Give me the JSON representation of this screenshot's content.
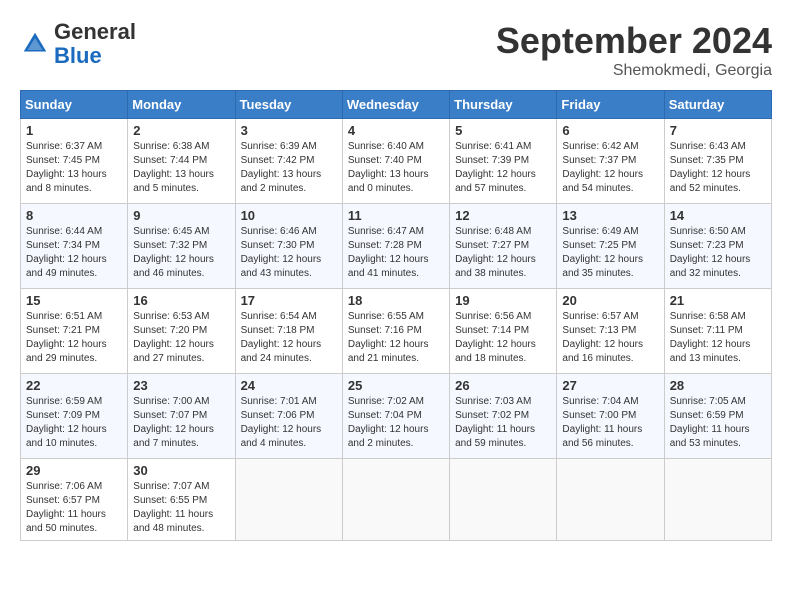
{
  "header": {
    "logo_general": "General",
    "logo_blue": "Blue",
    "month_title": "September 2024",
    "location": "Shemokmedi, Georgia"
  },
  "weekdays": [
    "Sunday",
    "Monday",
    "Tuesday",
    "Wednesday",
    "Thursday",
    "Friday",
    "Saturday"
  ],
  "weeks": [
    [
      {
        "day": "1",
        "sunrise": "Sunrise: 6:37 AM",
        "sunset": "Sunset: 7:45 PM",
        "daylight": "Daylight: 13 hours and 8 minutes."
      },
      {
        "day": "2",
        "sunrise": "Sunrise: 6:38 AM",
        "sunset": "Sunset: 7:44 PM",
        "daylight": "Daylight: 13 hours and 5 minutes."
      },
      {
        "day": "3",
        "sunrise": "Sunrise: 6:39 AM",
        "sunset": "Sunset: 7:42 PM",
        "daylight": "Daylight: 13 hours and 2 minutes."
      },
      {
        "day": "4",
        "sunrise": "Sunrise: 6:40 AM",
        "sunset": "Sunset: 7:40 PM",
        "daylight": "Daylight: 13 hours and 0 minutes."
      },
      {
        "day": "5",
        "sunrise": "Sunrise: 6:41 AM",
        "sunset": "Sunset: 7:39 PM",
        "daylight": "Daylight: 12 hours and 57 minutes."
      },
      {
        "day": "6",
        "sunrise": "Sunrise: 6:42 AM",
        "sunset": "Sunset: 7:37 PM",
        "daylight": "Daylight: 12 hours and 54 minutes."
      },
      {
        "day": "7",
        "sunrise": "Sunrise: 6:43 AM",
        "sunset": "Sunset: 7:35 PM",
        "daylight": "Daylight: 12 hours and 52 minutes."
      }
    ],
    [
      {
        "day": "8",
        "sunrise": "Sunrise: 6:44 AM",
        "sunset": "Sunset: 7:34 PM",
        "daylight": "Daylight: 12 hours and 49 minutes."
      },
      {
        "day": "9",
        "sunrise": "Sunrise: 6:45 AM",
        "sunset": "Sunset: 7:32 PM",
        "daylight": "Daylight: 12 hours and 46 minutes."
      },
      {
        "day": "10",
        "sunrise": "Sunrise: 6:46 AM",
        "sunset": "Sunset: 7:30 PM",
        "daylight": "Daylight: 12 hours and 43 minutes."
      },
      {
        "day": "11",
        "sunrise": "Sunrise: 6:47 AM",
        "sunset": "Sunset: 7:28 PM",
        "daylight": "Daylight: 12 hours and 41 minutes."
      },
      {
        "day": "12",
        "sunrise": "Sunrise: 6:48 AM",
        "sunset": "Sunset: 7:27 PM",
        "daylight": "Daylight: 12 hours and 38 minutes."
      },
      {
        "day": "13",
        "sunrise": "Sunrise: 6:49 AM",
        "sunset": "Sunset: 7:25 PM",
        "daylight": "Daylight: 12 hours and 35 minutes."
      },
      {
        "day": "14",
        "sunrise": "Sunrise: 6:50 AM",
        "sunset": "Sunset: 7:23 PM",
        "daylight": "Daylight: 12 hours and 32 minutes."
      }
    ],
    [
      {
        "day": "15",
        "sunrise": "Sunrise: 6:51 AM",
        "sunset": "Sunset: 7:21 PM",
        "daylight": "Daylight: 12 hours and 29 minutes."
      },
      {
        "day": "16",
        "sunrise": "Sunrise: 6:53 AM",
        "sunset": "Sunset: 7:20 PM",
        "daylight": "Daylight: 12 hours and 27 minutes."
      },
      {
        "day": "17",
        "sunrise": "Sunrise: 6:54 AM",
        "sunset": "Sunset: 7:18 PM",
        "daylight": "Daylight: 12 hours and 24 minutes."
      },
      {
        "day": "18",
        "sunrise": "Sunrise: 6:55 AM",
        "sunset": "Sunset: 7:16 PM",
        "daylight": "Daylight: 12 hours and 21 minutes."
      },
      {
        "day": "19",
        "sunrise": "Sunrise: 6:56 AM",
        "sunset": "Sunset: 7:14 PM",
        "daylight": "Daylight: 12 hours and 18 minutes."
      },
      {
        "day": "20",
        "sunrise": "Sunrise: 6:57 AM",
        "sunset": "Sunset: 7:13 PM",
        "daylight": "Daylight: 12 hours and 16 minutes."
      },
      {
        "day": "21",
        "sunrise": "Sunrise: 6:58 AM",
        "sunset": "Sunset: 7:11 PM",
        "daylight": "Daylight: 12 hours and 13 minutes."
      }
    ],
    [
      {
        "day": "22",
        "sunrise": "Sunrise: 6:59 AM",
        "sunset": "Sunset: 7:09 PM",
        "daylight": "Daylight: 12 hours and 10 minutes."
      },
      {
        "day": "23",
        "sunrise": "Sunrise: 7:00 AM",
        "sunset": "Sunset: 7:07 PM",
        "daylight": "Daylight: 12 hours and 7 minutes."
      },
      {
        "day": "24",
        "sunrise": "Sunrise: 7:01 AM",
        "sunset": "Sunset: 7:06 PM",
        "daylight": "Daylight: 12 hours and 4 minutes."
      },
      {
        "day": "25",
        "sunrise": "Sunrise: 7:02 AM",
        "sunset": "Sunset: 7:04 PM",
        "daylight": "Daylight: 12 hours and 2 minutes."
      },
      {
        "day": "26",
        "sunrise": "Sunrise: 7:03 AM",
        "sunset": "Sunset: 7:02 PM",
        "daylight": "Daylight: 11 hours and 59 minutes."
      },
      {
        "day": "27",
        "sunrise": "Sunrise: 7:04 AM",
        "sunset": "Sunset: 7:00 PM",
        "daylight": "Daylight: 11 hours and 56 minutes."
      },
      {
        "day": "28",
        "sunrise": "Sunrise: 7:05 AM",
        "sunset": "Sunset: 6:59 PM",
        "daylight": "Daylight: 11 hours and 53 minutes."
      }
    ],
    [
      {
        "day": "29",
        "sunrise": "Sunrise: 7:06 AM",
        "sunset": "Sunset: 6:57 PM",
        "daylight": "Daylight: 11 hours and 50 minutes."
      },
      {
        "day": "30",
        "sunrise": "Sunrise: 7:07 AM",
        "sunset": "Sunset: 6:55 PM",
        "daylight": "Daylight: 11 hours and 48 minutes."
      },
      null,
      null,
      null,
      null,
      null
    ]
  ]
}
